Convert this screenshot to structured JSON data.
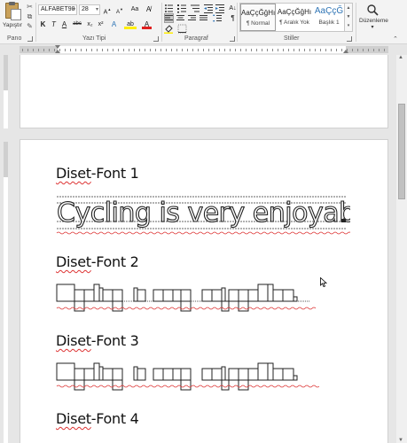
{
  "ribbon": {
    "clipboard": {
      "paste_label": "Yapıştır",
      "group_label": "Pano"
    },
    "font": {
      "font_name": "ALFABET98",
      "font_size": "28",
      "grow_shrink": "Aa",
      "bold": "K",
      "italic": "T",
      "underline": "A",
      "strike": "abc",
      "subscript": "x₂",
      "superscript": "x²",
      "effects": "A",
      "highlight": "ab",
      "color": "A",
      "group_label": "Yazı Tipi"
    },
    "paragraph": {
      "group_label": "Paragraf",
      "pilcrow": "¶"
    },
    "styles": {
      "items": [
        {
          "preview": "AaÇçĞğHı",
          "name": "¶ Normal"
        },
        {
          "preview": "AaÇçĞğHı",
          "name": "¶ Aralık Yok"
        },
        {
          "preview": "AaÇçĞ",
          "name": "Başlık 1"
        }
      ],
      "group_label": "Stiller"
    },
    "editing": {
      "label": "Düzenleme"
    }
  },
  "document": {
    "sections": [
      {
        "heading": "Diset-Font 1",
        "heading_plain": "Diset",
        "heading_rest": "-Font 1",
        "sample": "Cycling is very enjoyable."
      },
      {
        "heading": "Diset-Font 2",
        "heading_plain": "Diset",
        "heading_rest": "-Font 2",
        "sample": "Cycling is very enjoyable."
      },
      {
        "heading": "Diset-Font 3",
        "heading_plain": "Diset",
        "heading_rest": "-Font 3",
        "sample": "Cycling is very enjoyable."
      },
      {
        "heading": "Diset-Font 4",
        "heading_plain": "Diset",
        "heading_rest": "-Font 4",
        "sample": ""
      }
    ]
  },
  "colors": {
    "accent": "#2e74b5",
    "spell_error": "#d33333"
  }
}
